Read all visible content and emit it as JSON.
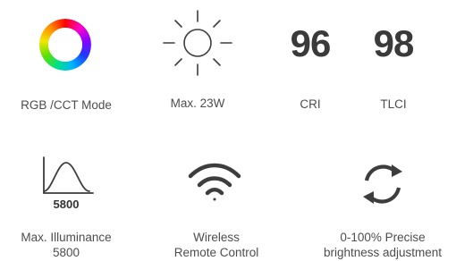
{
  "features": {
    "rgb_cct": {
      "label": "RGB /CCT Mode",
      "icon": "color-wheel-icon"
    },
    "power": {
      "label": "Max. 23W",
      "icon": "sun-icon"
    },
    "cri": {
      "value": "96",
      "label": "CRI"
    },
    "tlci": {
      "value": "98",
      "label": "TLCI"
    },
    "illuminance": {
      "icon": "illuminance-curve-icon",
      "icon_value": "5800",
      "label_line1": "Max. Illuminance",
      "label_line2": "5800"
    },
    "wireless": {
      "icon": "wifi-icon",
      "label_line1": "Wireless",
      "label_line2": "Remote Control"
    },
    "brightness": {
      "icon": "refresh-cycle-icon",
      "label_line1": "0-100% Precise",
      "label_line2": "brightness adjustment"
    }
  },
  "colors": {
    "icon_stroke": "#3d3d3d",
    "text": "#4d4d4d",
    "number": "#3a3a3a"
  }
}
